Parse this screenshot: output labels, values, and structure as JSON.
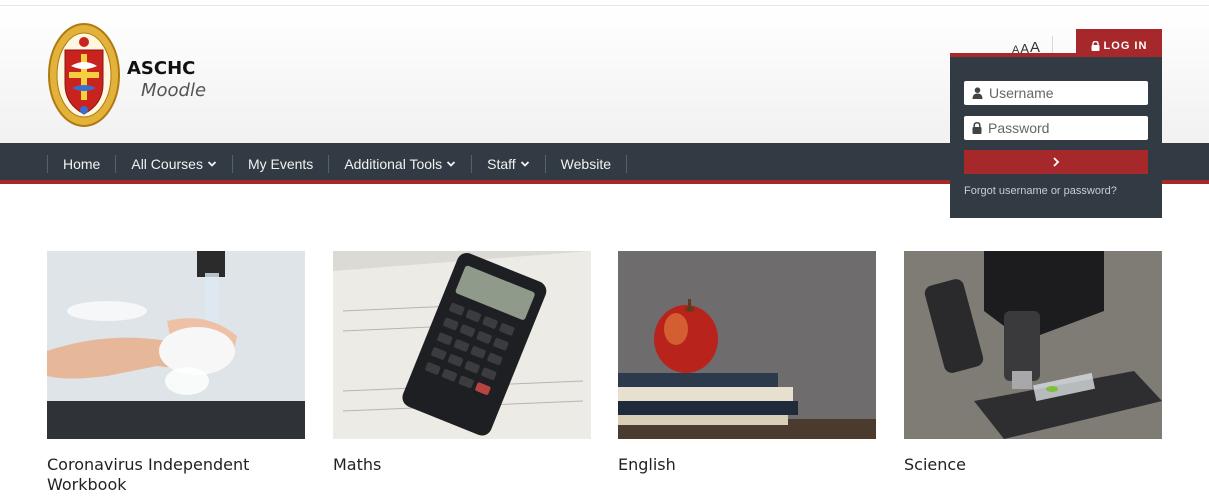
{
  "brand": {
    "title": "ASCHC",
    "subtitle": "Moodle",
    "logo_icon": "school-crest-icon"
  },
  "header": {
    "font_size_labels": [
      "A",
      "A",
      "A"
    ],
    "login_label": "LOG IN"
  },
  "nav": {
    "items": [
      {
        "label": "Home",
        "dropdown": false
      },
      {
        "label": "All Courses",
        "dropdown": true
      },
      {
        "label": "My Events",
        "dropdown": false
      },
      {
        "label": "Additional Tools",
        "dropdown": true
      },
      {
        "label": "Staff",
        "dropdown": true
      },
      {
        "label": "Website",
        "dropdown": false
      }
    ]
  },
  "login": {
    "username_placeholder": "Username",
    "password_placeholder": "Password",
    "forgot_label": "Forgot username or password?"
  },
  "courses": [
    {
      "name": "Coronavirus Independent Workbook"
    },
    {
      "name": "Maths"
    },
    {
      "name": "English"
    },
    {
      "name": "Science"
    }
  ],
  "colors": {
    "accent": "#a6282a",
    "nav_bg": "#323b43"
  }
}
